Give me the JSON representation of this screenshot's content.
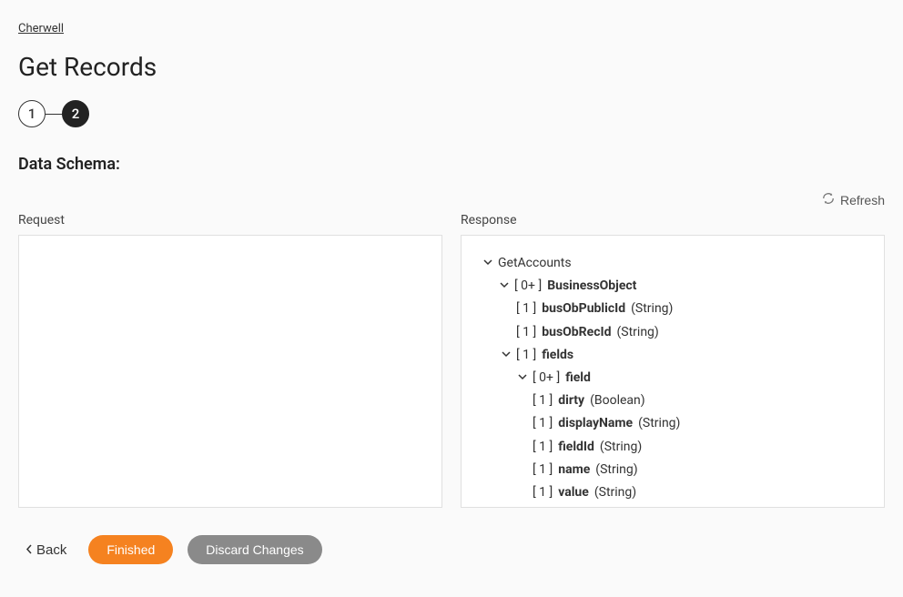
{
  "breadcrumb": "Cherwell",
  "page_title": "Get Records",
  "stepper": {
    "step1": "1",
    "step2": "2"
  },
  "section_title": "Data Schema:",
  "refresh_label": "Refresh",
  "request_label": "Request",
  "response_label": "Response",
  "tree": {
    "root": "GetAccounts",
    "bo_card": "[ 0+ ]",
    "bo_name": "BusinessObject",
    "pubid_card": "[ 1 ]",
    "pubid_name": "busObPublicId",
    "pubid_type": "(String)",
    "recid_card": "[ 1 ]",
    "recid_name": "busObRecId",
    "recid_type": "(String)",
    "fields_card": "[ 1 ]",
    "fields_name": "fields",
    "field_card": "[ 0+ ]",
    "field_name": "field",
    "dirty_card": "[ 1 ]",
    "dirty_name": "dirty",
    "dirty_type": "(Boolean)",
    "disp_card": "[ 1 ]",
    "disp_name": "displayName",
    "disp_type": "(String)",
    "fieldid_card": "[ 1 ]",
    "fieldid_name": "fieldId",
    "fieldid_type": "(String)",
    "name_card": "[ 1 ]",
    "name_name": "name",
    "name_type": "(String)",
    "value_card": "[ 1 ]",
    "value_name": "value",
    "value_type": "(String)"
  },
  "footer": {
    "back": "Back",
    "finished": "Finished",
    "discard": "Discard Changes"
  }
}
